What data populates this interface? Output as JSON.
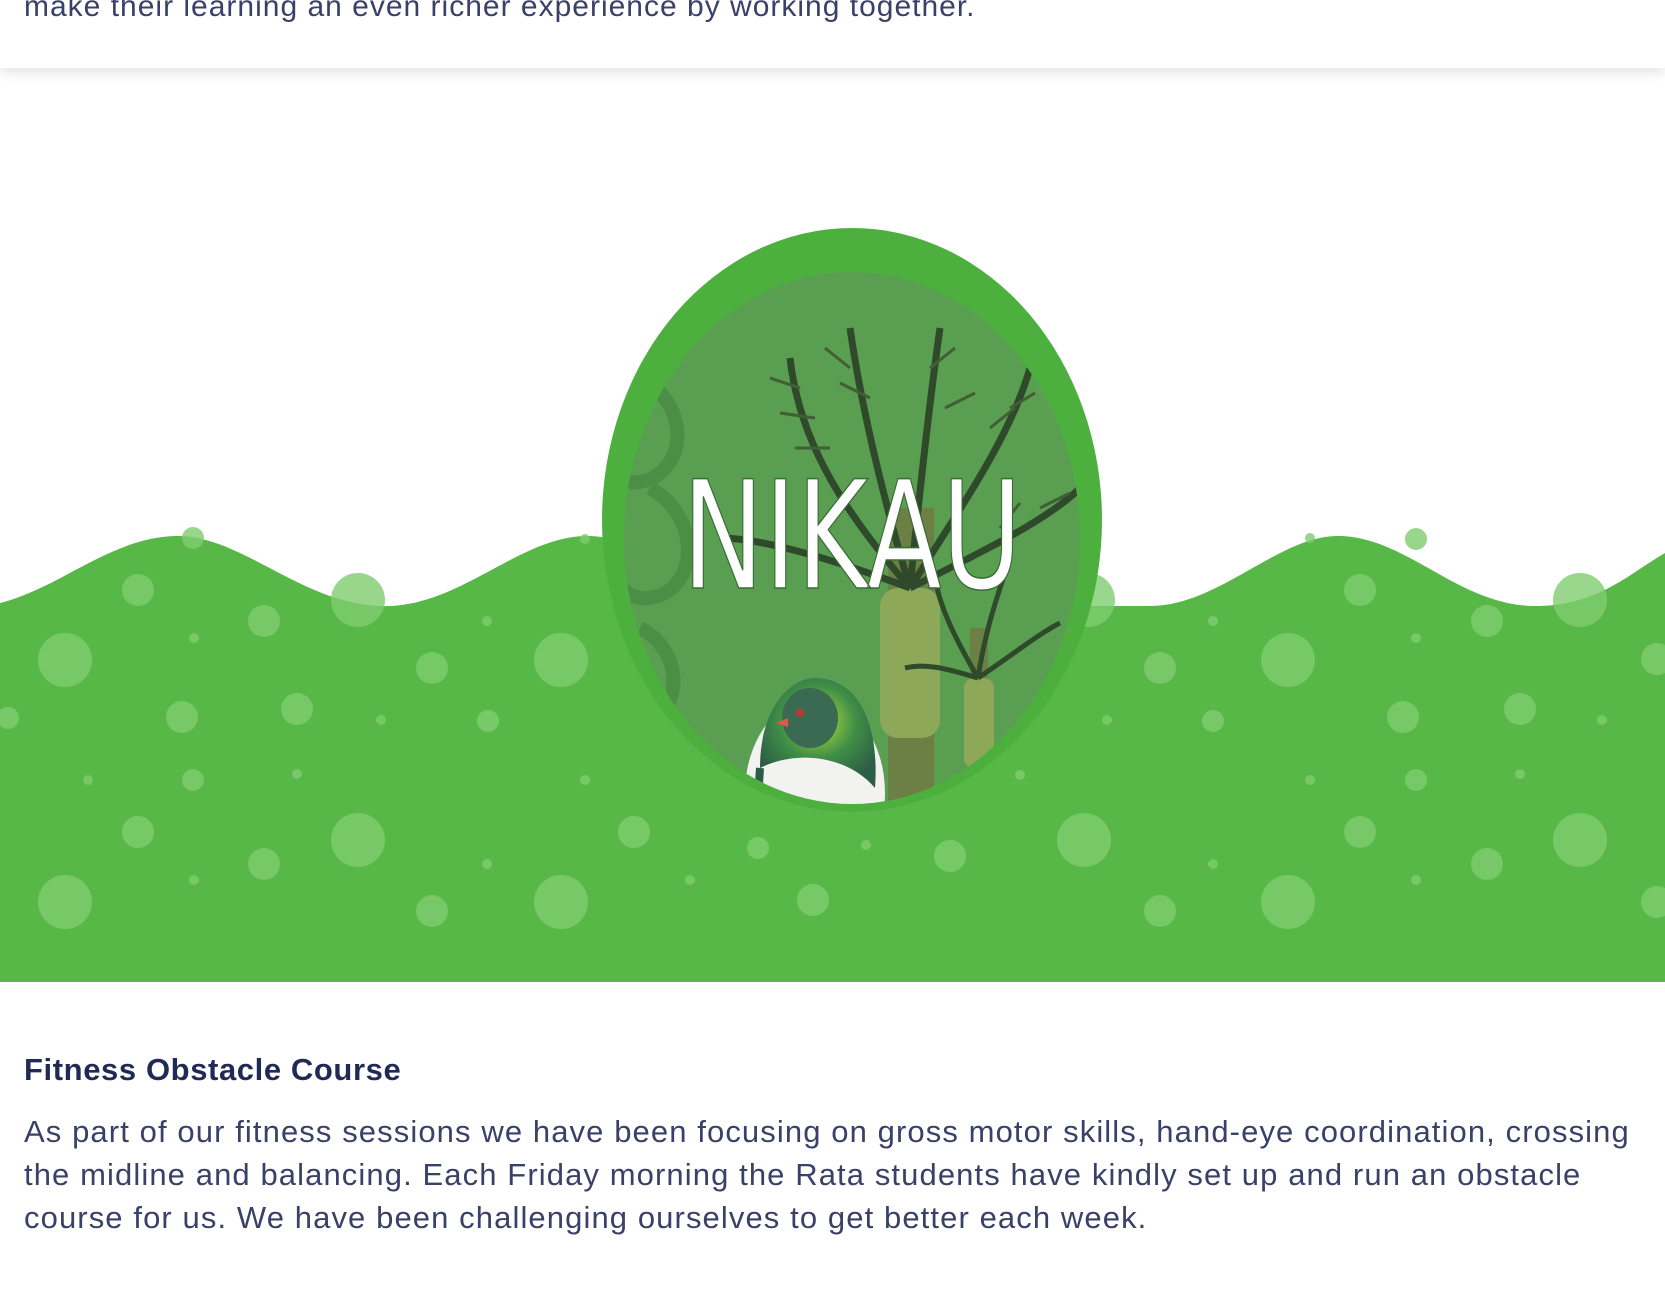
{
  "intro": {
    "text": "make their learning an even richer experience by working together."
  },
  "banner": {
    "logo_text": "NIKAU",
    "colors": {
      "wave_green": "#58b847",
      "oval_border": "#4caf3e",
      "oval_inner": "#5a9e52",
      "dots": "#7fcd6f"
    }
  },
  "section": {
    "title": "Fitness Obstacle Course",
    "body": "As part of our fitness sessions we have been focusing on gross motor skills, hand-eye coordination, crossing the midline and balancing. Each Friday morning the Rata students have kindly set up and run an obstacle course for us. We have been challenging ourselves to get better each week."
  },
  "theme": {
    "text_color": "#3a4168",
    "heading_color": "#1f2a55"
  }
}
